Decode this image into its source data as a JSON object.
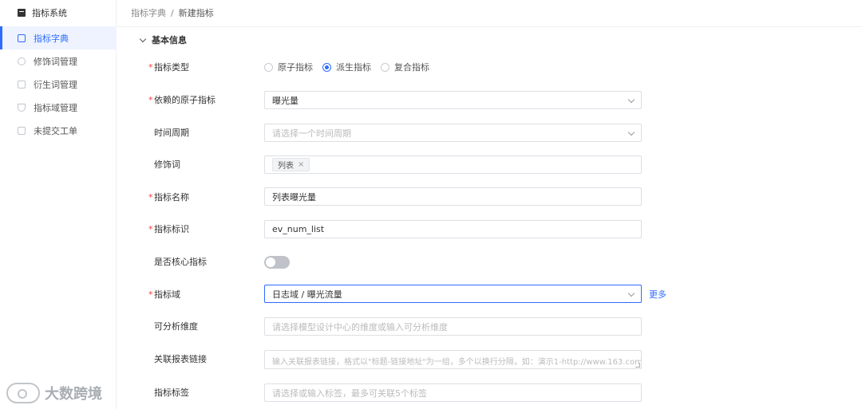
{
  "app": {
    "title": "指标系统"
  },
  "sidebar": {
    "items": [
      {
        "label": "指标字典",
        "active": true,
        "icon": "book-icon"
      },
      {
        "label": "修饰词管理",
        "active": false,
        "icon": "tag-icon"
      },
      {
        "label": "衍生词管理",
        "active": false,
        "icon": "grid-icon"
      },
      {
        "label": "指标域管理",
        "active": false,
        "icon": "tree-icon"
      },
      {
        "label": "未提交工单",
        "active": false,
        "icon": "ticket-icon"
      }
    ]
  },
  "breadcrumb": {
    "parent": "指标字典",
    "separator": "/",
    "current": "新建指标"
  },
  "section": {
    "title": "基本信息"
  },
  "form": {
    "metric_type": {
      "label": "指标类型",
      "required": true,
      "options": [
        "原子指标",
        "派生指标",
        "复合指标"
      ],
      "selected": "派生指标"
    },
    "atomic_metric": {
      "label": "依赖的原子指标",
      "required": true,
      "value": "曝光量"
    },
    "time_period": {
      "label": "时间周期",
      "required": false,
      "placeholder": "请选择一个时间周期"
    },
    "modifier": {
      "label": "修饰词",
      "required": false,
      "tags": [
        "列表"
      ],
      "tag_close": "×"
    },
    "metric_name": {
      "label": "指标名称",
      "required": true,
      "value": "列表曝光量"
    },
    "metric_id": {
      "label": "指标标识",
      "required": true,
      "value": "ev_num_list"
    },
    "is_core": {
      "label": "是否核心指标",
      "required": false,
      "value": false
    },
    "metric_domain": {
      "label": "指标域",
      "required": true,
      "value": "日志域 / 曝光流量",
      "more_label": "更多"
    },
    "dimensions": {
      "label": "可分析维度",
      "required": false,
      "placeholder": "请选择模型设计中心的维度或输入可分析维度"
    },
    "report_links": {
      "label": "关联报表链接",
      "required": false,
      "placeholder": "输入关联报表链接，格式以\"标题-链接地址\"为一组，多个以换行分隔，如：演示1-http://www.163.com"
    },
    "metric_tags": {
      "label": "指标标签",
      "required": false,
      "placeholder": "请选择或输入标签，最多可关联5个标签"
    }
  },
  "required_mark": "*",
  "watermark": {
    "text": "大数跨境"
  }
}
